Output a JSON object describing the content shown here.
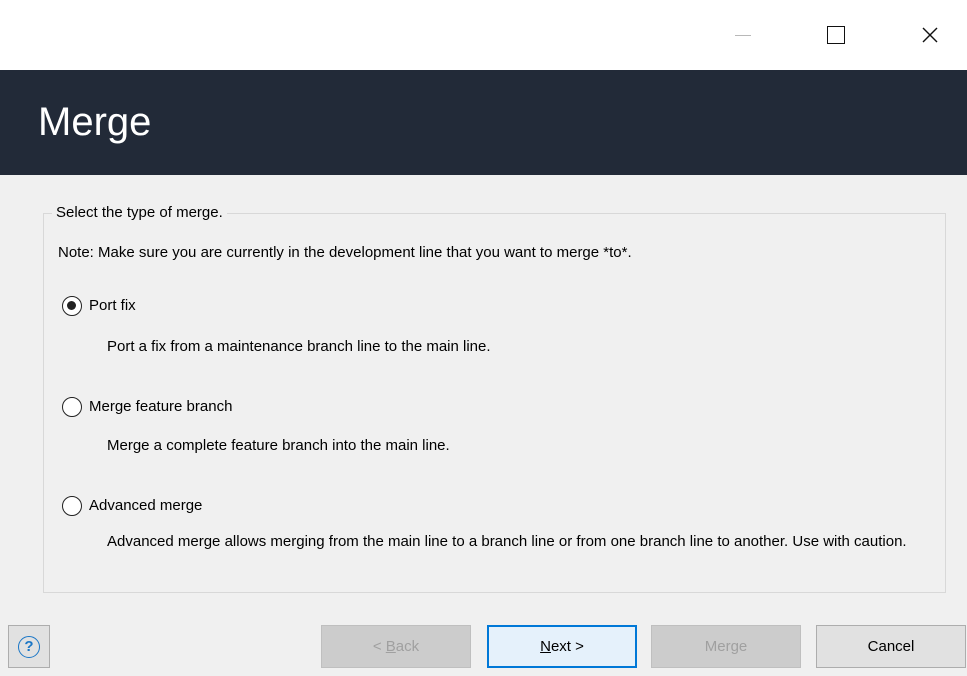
{
  "window": {
    "minimize_glyph": "—",
    "close_glyph": "✕"
  },
  "header": {
    "title": "Merge"
  },
  "group": {
    "legend": "Select the type of merge.",
    "note": "Note: Make sure you are currently in the development line that you want to merge *to*."
  },
  "options": [
    {
      "label": "Port fix",
      "description": "Port a fix from a maintenance branch line to the main line.",
      "selected": true
    },
    {
      "label": "Merge feature branch",
      "description": "Merge a complete feature branch into the main line.",
      "selected": false
    },
    {
      "label": "Advanced merge",
      "description": "Advanced merge allows merging from the main line to a branch line or from one branch line to another. Use with caution.",
      "selected": false
    }
  ],
  "buttons": {
    "help_glyph": "?",
    "back_prefix": "< ",
    "back_mnemonic": "B",
    "back_rest": "ack",
    "next_mnemonic": "N",
    "next_rest": "ext >",
    "merge": "Merge",
    "cancel": "Cancel"
  },
  "colors": {
    "header_bg": "#222a38",
    "primary_border": "#0078d7",
    "help_icon": "#1a76c6"
  }
}
